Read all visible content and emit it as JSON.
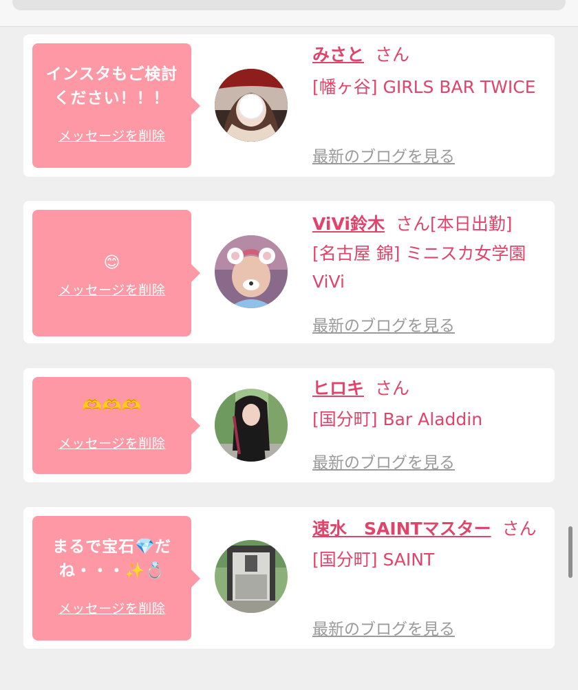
{
  "theme": {
    "bubble_color": "#ff98a5",
    "name_color": "#e0446a",
    "link_gray": "#9a9a9a",
    "background": "#efefef"
  },
  "messages": [
    {
      "message": "インスタもご検討ください！！！",
      "delete_label": "メッセージを削除",
      "name": "みさと",
      "honorific": "さん",
      "status": "",
      "shop": "[幡ヶ谷] GIRLS BAR TWICE",
      "blog_label": "最新のブログを見る",
      "avatar": "photo-woman-face-sticker"
    },
    {
      "message": "😊",
      "delete_label": "メッセージを削除",
      "name": "ViVi鈴木",
      "honorific": "さん",
      "status": "[本日出勤]",
      "shop": "[名古屋 錦] ミニスカ女学園ViVi",
      "blog_label": "最新のブログを見る",
      "avatar": "photo-bear-ear-filter"
    },
    {
      "message": "🫶🫶🫶",
      "delete_label": "メッセージを削除",
      "name": "ヒロキ",
      "honorific": "さん",
      "status": "",
      "shop": "[国分町] Bar Aladdin",
      "blog_label": "最新のブログを見る",
      "avatar": "photo-woman-long-hair"
    },
    {
      "message_parts": [
        "まるで宝石",
        "💎",
        "だね・・・",
        "✨💍"
      ],
      "delete_label": "メッセージを削除",
      "name": "速水　SAINTマスター",
      "honorific": "さん",
      "status": "",
      "shop": "[国分町] SAINT",
      "blog_label": "最新のブログを見る",
      "avatar": "photo-van-interior"
    }
  ]
}
